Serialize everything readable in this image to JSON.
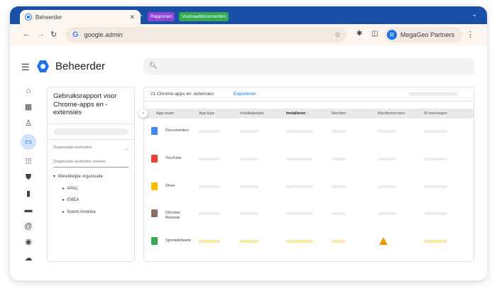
{
  "browser": {
    "tab_title": "Beheerder",
    "bookmarks": [
      {
        "label": "Rapporten",
        "color": "#8e44d6"
      },
      {
        "label": "Voorraaddocumenten",
        "color": "#34a853"
      }
    ],
    "url": "google.admin",
    "profile_initial": "R",
    "profile_name": "MegaGeo Partners"
  },
  "app": {
    "title": "Beheerder",
    "search_placeholder": ""
  },
  "rail": [
    "home-icon",
    "dashboard-icon",
    "user-icon",
    "devices-icon",
    "apps-icon",
    "security-icon",
    "reports-icon",
    "billing-icon",
    "account-icon",
    "rules-icon",
    "cloud-icon"
  ],
  "left_panel": {
    "title": "Gebruiksrapport voor Chrome-apps en -extensies",
    "section": "Organisatie-eenheden",
    "search_placeholder": "Organisatie-eenheden zoeken",
    "tree": [
      "Wereldwijde organisatie",
      "APAC",
      "EMEA",
      "Noord-Amerika"
    ]
  },
  "table": {
    "count_label": "21 Chrome-apps en -extensies",
    "export_label": "Exporteren",
    "columns": [
      "App-naam",
      "App-type",
      "Installatietype",
      "Installeren",
      "Rechten",
      "Manifestversies",
      "ID toevoegen"
    ],
    "rows": [
      {
        "name": "Documenten",
        "color": "#4285f4"
      },
      {
        "name": "YouTube",
        "color": "#ea4335"
      },
      {
        "name": "Drive",
        "color": "#fbbc04"
      },
      {
        "name": "Chrome Remote",
        "color": "#8d6e63"
      },
      {
        "name": "Spreadsheets",
        "color": "#34a853",
        "warning": true
      }
    ]
  },
  "colors": {
    "tabbar": "#1a4fa8",
    "accent": "#1a73e8",
    "warning": "#f29900"
  }
}
